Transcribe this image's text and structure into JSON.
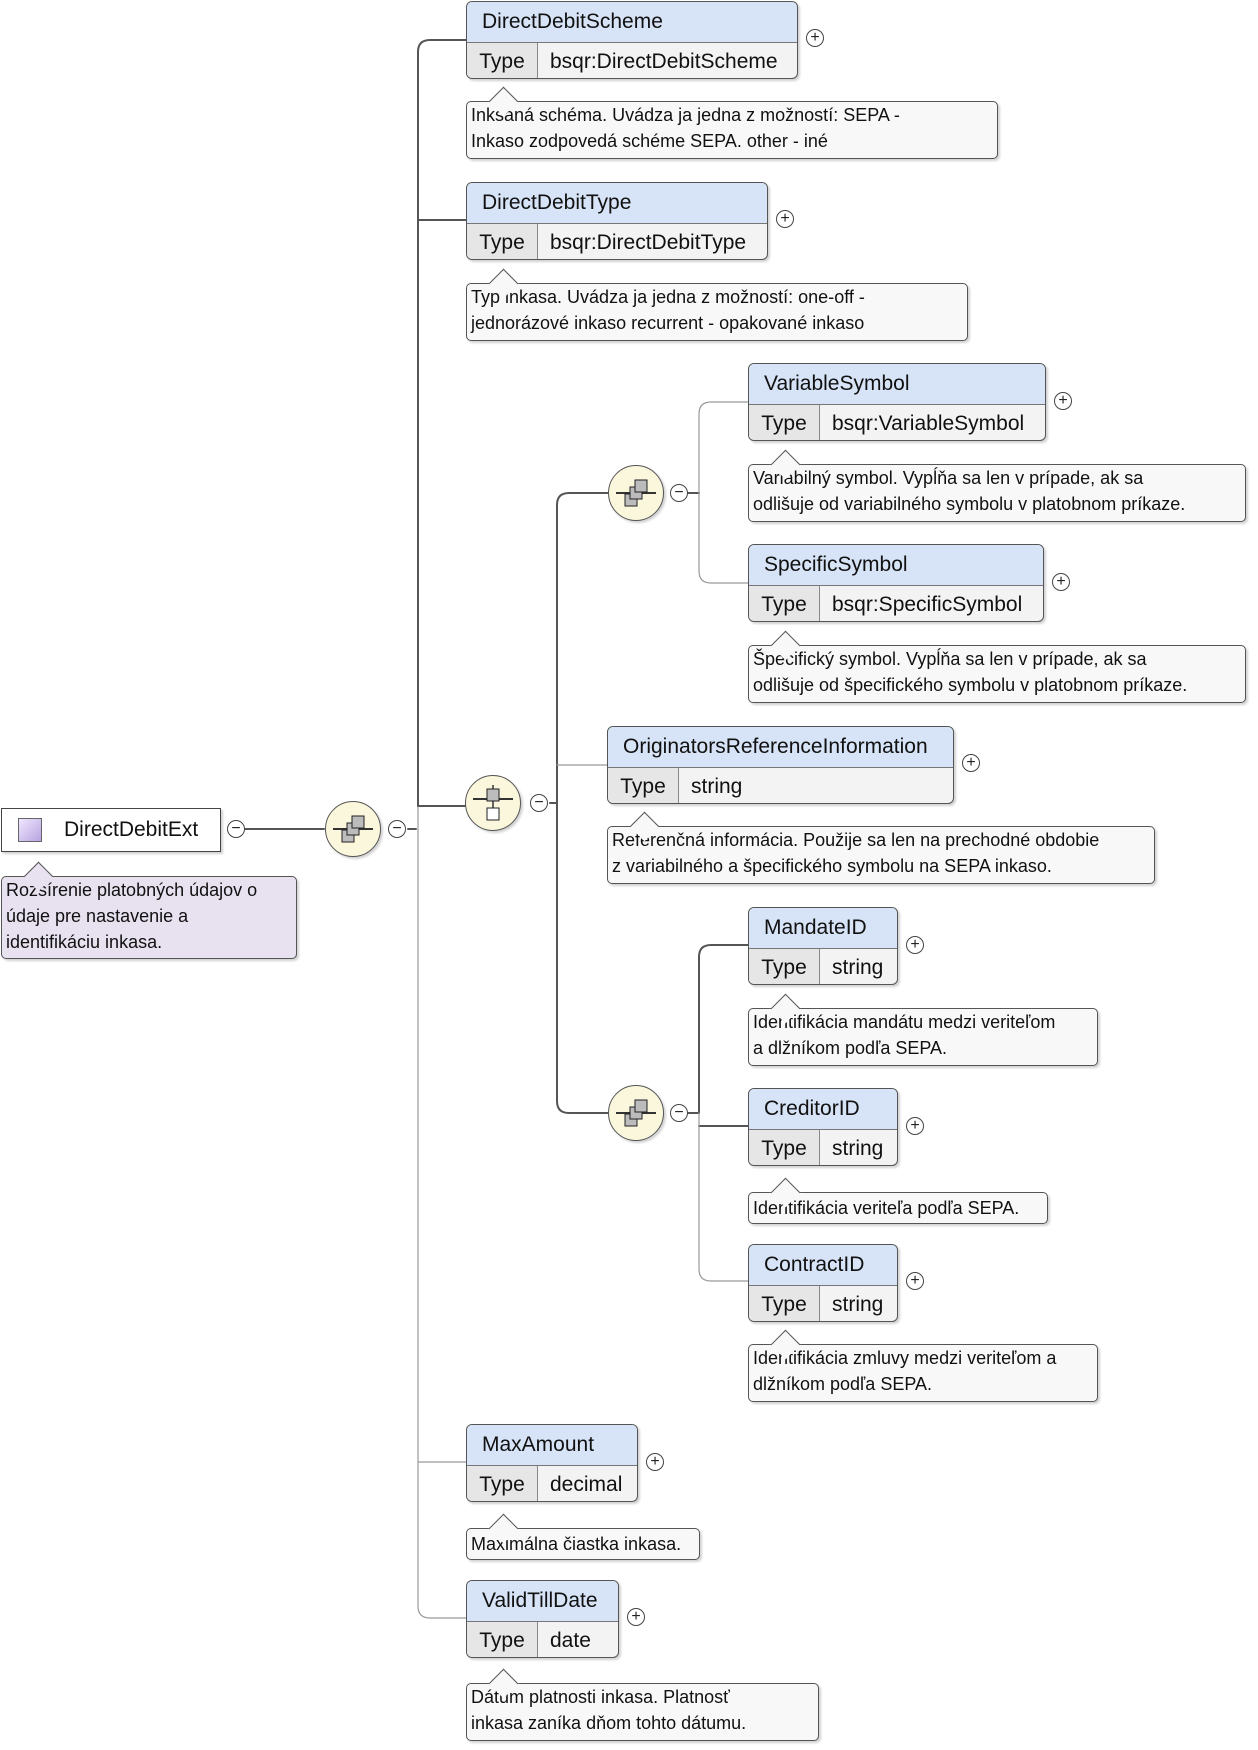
{
  "root": {
    "name": "DirectDebitExt",
    "annotation": [
      "Rozšírenie platobných údajov o",
      "údaje pre nastavenie a",
      "identifikáciu inkasa."
    ]
  },
  "type_label": "Type",
  "elements": [
    {
      "name": "DirectDebitScheme",
      "type": "bsqr:DirectDebitScheme",
      "annotation": [
        "Inksaná schéma. Uvádza ja jedna z možností: SEPA -",
        "Inkaso zodpovedá schéme SEPA. other - iné"
      ]
    },
    {
      "name": "DirectDebitType",
      "type": "bsqr:DirectDebitType",
      "annotation": [
        "Typ inkasa. Uvádza ja jedna z možností: one-off -",
        "jednorázové inkaso recurrent - opakované inkaso"
      ]
    },
    {
      "name": "VariableSymbol",
      "type": "bsqr:VariableSymbol",
      "annotation": [
        "Variabilný symbol. Vypĺňa sa len v prípade, ak sa",
        "odlišuje od variabilného symbolu v platobnom príkaze."
      ]
    },
    {
      "name": "SpecificSymbol",
      "type": "bsqr:SpecificSymbol",
      "annotation": [
        "Špecifický symbol. Vypĺňa sa len v prípade, ak sa",
        "odlišuje od špecifického symbolu v platobnom príkaze."
      ]
    },
    {
      "name": "OriginatorsReferenceInformation",
      "type": "string",
      "annotation": [
        "Referenčná informácia. Použije sa len na prechodné obdobie",
        "z variabilného a špecifického symbolu na SEPA inkaso."
      ]
    },
    {
      "name": "MandateID",
      "type": "string",
      "annotation": [
        "Identifikácia mandátu medzi veriteľom",
        "a dlžníkom podľa SEPA."
      ]
    },
    {
      "name": "CreditorID",
      "type": "string",
      "annotation": [
        "Identifikácia veriteľa podľa SEPA."
      ]
    },
    {
      "name": "ContractID",
      "type": "string",
      "annotation": [
        "Identifikácia zmluvy medzi veriteľom a",
        "dlžníkom podľa SEPA."
      ]
    },
    {
      "name": "MaxAmount",
      "type": "decimal",
      "annotation": [
        "Maximálna čiastka inkasa."
      ]
    },
    {
      "name": "ValidTillDate",
      "type": "date",
      "annotation": [
        "Dátum platnosti inkasa. Platnosť",
        "inkasa zaníka dňom tohto dátumu."
      ]
    }
  ],
  "symbols": {
    "expand": "+",
    "collapse": "−"
  },
  "colors": {
    "element_header": "#d7e3f6",
    "root_annotation": "#e8e1f0",
    "compositor": "#fbf7dd"
  }
}
